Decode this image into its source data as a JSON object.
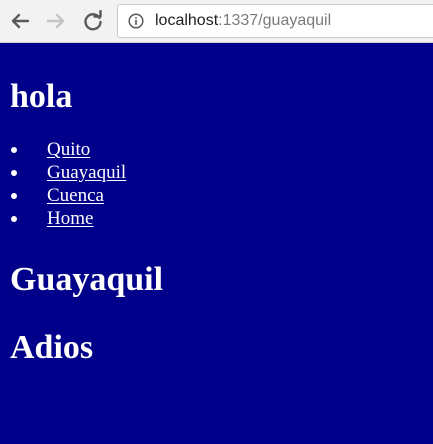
{
  "browser": {
    "back_icon": "arrow-left-icon",
    "forward_icon": "arrow-right-icon",
    "reload_icon": "reload-icon",
    "site_info_icon": "info-circle-icon",
    "url_host": "localhost",
    "url_rest": ":1337/guayaquil"
  },
  "page": {
    "greeting": "hola",
    "nav_items": [
      {
        "label": "Quito"
      },
      {
        "label": "Guayaquil"
      },
      {
        "label": "Cuenca"
      },
      {
        "label": "Home"
      }
    ],
    "city_heading": "Guayaquil",
    "farewell": "Adios"
  },
  "colors": {
    "page_background": "#00008b",
    "text": "#ffffff",
    "toolbar_background": "#f2f2f2"
  }
}
